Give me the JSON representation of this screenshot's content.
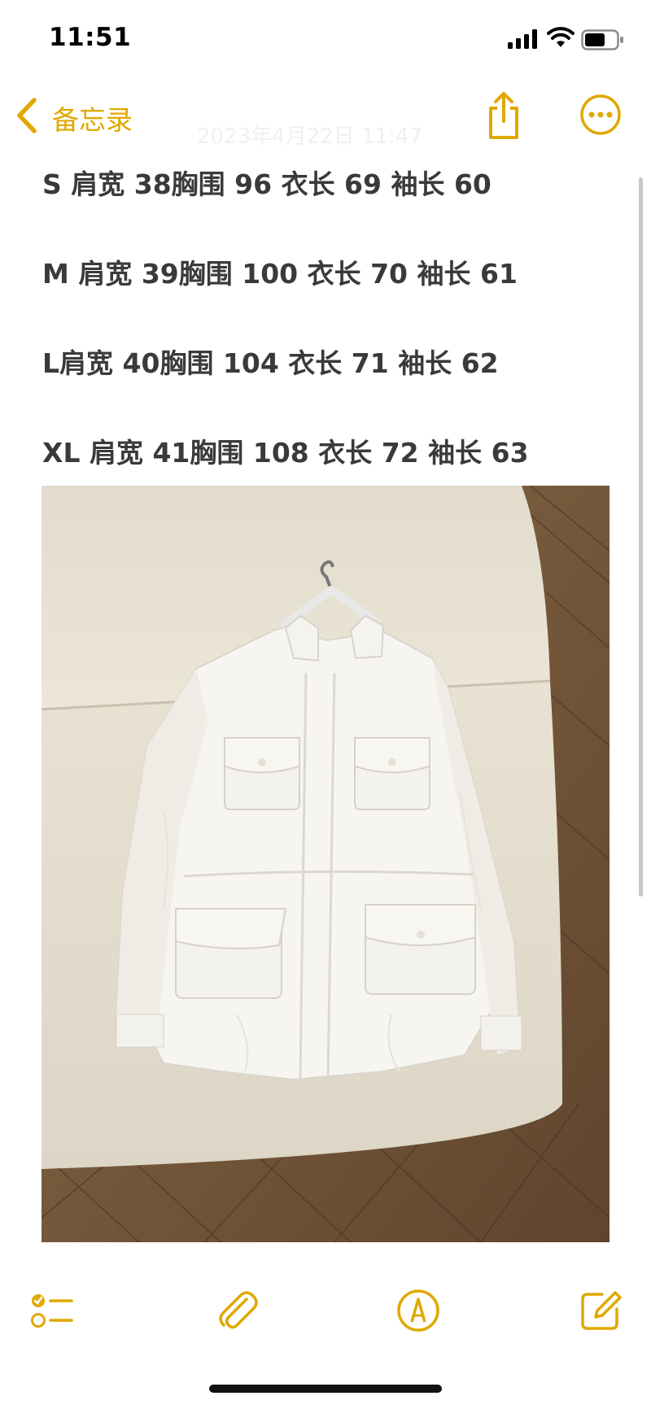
{
  "status_bar": {
    "time": "11:51"
  },
  "nav": {
    "back_label": "备忘录",
    "ghost_date": "2023年4月22日 11:47"
  },
  "note": {
    "lines": [
      "S 肩宽 38胸围 96 衣长 69 袖长 60",
      "M 肩宽 39胸围 100 衣长 70 袖长 61",
      "L肩宽 40胸围 104 衣长 71 袖长 62",
      "XL 肩宽 41胸围 108 衣长 72 袖长 63"
    ]
  },
  "photo": {
    "subject": "white linen field jacket on hanger"
  },
  "toolbar": {
    "items": [
      "checklist-icon",
      "paperclip-icon",
      "markup-pen-icon",
      "compose-icon"
    ]
  },
  "colors": {
    "accent": "#E0A800",
    "text": "#3A3A3A",
    "background": "#FFFFFF"
  }
}
